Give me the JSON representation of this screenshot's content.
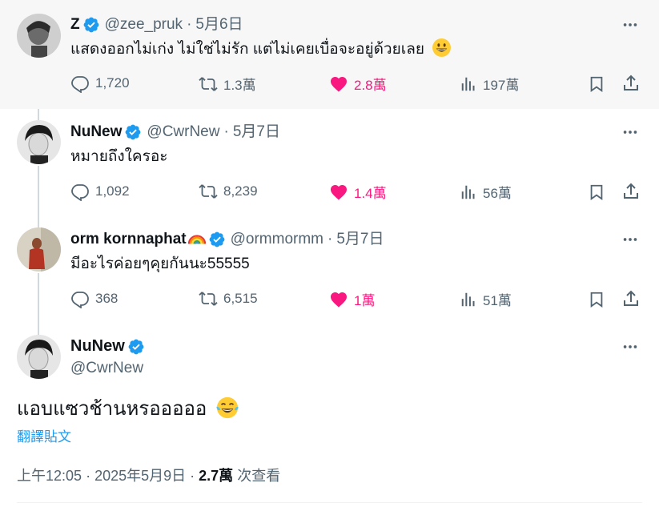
{
  "replies": [
    {
      "name": "Z",
      "handle": "@zee_pruk",
      "date": "5月6日",
      "text": "แสดงออกไม่เก่ง ไม่ใช่ไม่รัก แต่ไม่เคยเบื่อจะอยู่ด้วยเลย",
      "emoji": "grinning-face",
      "replies": "1,720",
      "reposts": "1.3萬",
      "likes": "2.8萬",
      "views": "197萬",
      "liked": true
    },
    {
      "name": "NuNew",
      "handle": "@CwrNew",
      "date": "5月7日",
      "text": "หมายถึงใครอะ",
      "replies": "1,092",
      "reposts": "8,239",
      "likes": "1.4萬",
      "views": "56萬",
      "liked": true
    },
    {
      "name": "orm kornnaphat",
      "handle": "@ormmormm",
      "date": "5月7日",
      "text": "มีอะไรค่อยๆคุยกันนะ55555",
      "name_emoji": "rainbow",
      "replies": "368",
      "reposts": "6,515",
      "likes": "1萬",
      "views": "51萬",
      "liked": true
    }
  ],
  "main": {
    "name": "NuNew",
    "handle": "@CwrNew",
    "text": "แอบแซวช้านหรอออออ",
    "emoji": "tears-of-joy",
    "translate_label": "翻譯貼文",
    "time": "上午12:05",
    "date": "2025年5月9日",
    "views": "2.7萬",
    "views_label": "次查看"
  },
  "colors": {
    "verified": "#1d9bf0",
    "like": "#f91880",
    "secondary": "#536471",
    "link": "#1d9bf0"
  }
}
